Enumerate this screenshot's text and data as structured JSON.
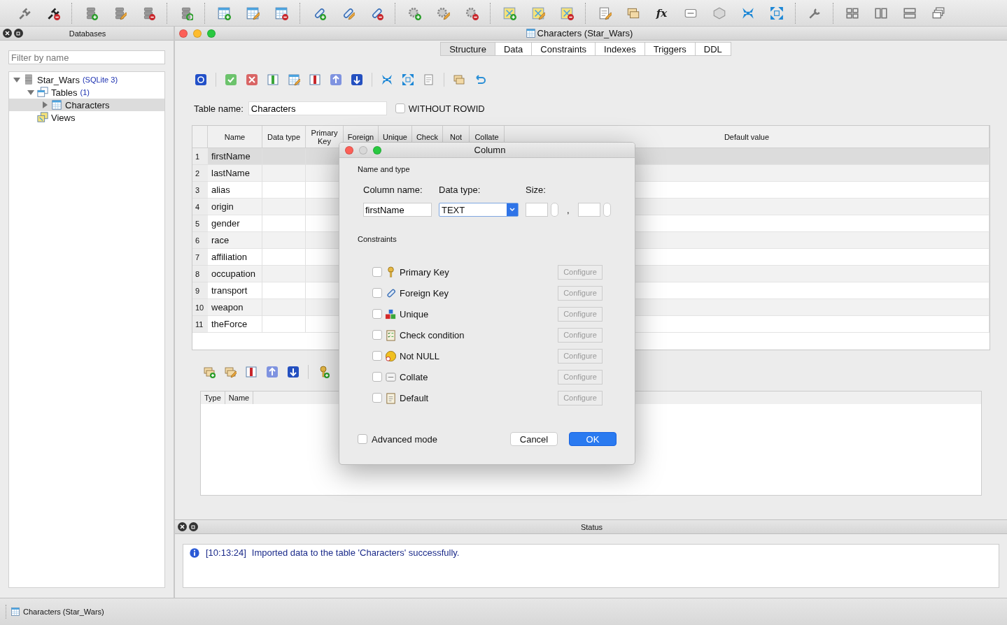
{
  "main_toolbar": {
    "function_button": "fx"
  },
  "databases_panel": {
    "title": "Databases",
    "filter": {
      "placeholder": "Filter by name"
    },
    "tree": [
      {
        "label": "Star_Wars",
        "detail": "(SQLite 3)",
        "kind": "database",
        "expanded": true,
        "selected": false,
        "children": [
          {
            "label": "Tables",
            "detail": "(1)",
            "kind": "tables",
            "expanded": true,
            "selected": false,
            "children": [
              {
                "label": "Characters",
                "kind": "table",
                "expanded": false,
                "selected": true
              }
            ]
          },
          {
            "label": "Views",
            "kind": "views",
            "selected": false
          }
        ]
      }
    ]
  },
  "editor_window": {
    "title": "Characters (Star_Wars)",
    "tabs": [
      {
        "label": "Structure",
        "selected": true
      },
      {
        "label": "Data",
        "selected": false
      },
      {
        "label": "Constraints",
        "selected": false
      },
      {
        "label": "Indexes",
        "selected": false
      },
      {
        "label": "Triggers",
        "selected": false
      },
      {
        "label": "DDL",
        "selected": false
      }
    ],
    "table_name_label": "Table name:",
    "table_name": "Characters",
    "without_rowid": {
      "label": "WITHOUT ROWID",
      "checked": false
    },
    "columns_table": {
      "columns": [
        "Name",
        "Data type",
        "Primary Key",
        "Foreign",
        "Unique",
        "Check",
        "Not",
        "Collate",
        "Default value"
      ],
      "rows": [
        {
          "number": "1",
          "name": "firstName",
          "selected": true
        },
        {
          "number": "2",
          "name": "lastName",
          "selected": false
        },
        {
          "number": "3",
          "name": "alias",
          "selected": false
        },
        {
          "number": "4",
          "name": "origin",
          "selected": false
        },
        {
          "number": "5",
          "name": "gender",
          "selected": false
        },
        {
          "number": "6",
          "name": "race",
          "selected": false
        },
        {
          "number": "7",
          "name": "affiliation",
          "selected": false
        },
        {
          "number": "8",
          "name": "occupation",
          "selected": false
        },
        {
          "number": "9",
          "name": "transport",
          "selected": false
        },
        {
          "number": "10",
          "name": "weapon",
          "selected": false
        },
        {
          "number": "11",
          "name": "theForce",
          "selected": false
        }
      ]
    },
    "constraints_table": {
      "columns": [
        "Type",
        "Name"
      ]
    }
  },
  "status_panel": {
    "title": "Status",
    "messages": [
      {
        "time": "[10:13:24]",
        "text": "Imported data to the table 'Characters' successfully."
      }
    ]
  },
  "taskbar": [
    {
      "label": "Characters (Star_Wars)"
    }
  ],
  "column_dialog": {
    "title": "Column",
    "name_type_title": "Name and type",
    "column_name_label": "Column name:",
    "column_name": "firstName",
    "data_type_label": "Data type:",
    "data_type": "TEXT",
    "size_label": "Size:",
    "size_separator": ",",
    "constraints_title": "Constraints",
    "constraints": [
      {
        "label": "Primary Key",
        "kind": "key",
        "checked": false,
        "button": "Configure",
        "button_disabled": true
      },
      {
        "label": "Foreign Key",
        "kind": "link",
        "checked": false,
        "button": "Configure",
        "button_disabled": true
      },
      {
        "label": "Unique",
        "kind": "blocks",
        "checked": false,
        "button": "Configure",
        "button_disabled": true
      },
      {
        "label": "Check condition",
        "kind": "checklist",
        "checked": false,
        "button": "Configure",
        "button_disabled": true
      },
      {
        "label": "Not NULL",
        "kind": "null",
        "checked": false,
        "button": "Configure",
        "button_disabled": true
      },
      {
        "label": "Collate",
        "kind": "sort",
        "checked": false,
        "button": "Configure",
        "button_disabled": true
      },
      {
        "label": "Default",
        "kind": "clipboard",
        "checked": false,
        "button": "Configure",
        "button_disabled": true
      }
    ],
    "advanced_mode": {
      "label": "Advanced mode",
      "checked": false
    },
    "buttons": [
      {
        "label": "Cancel",
        "kind": "secondary"
      },
      {
        "label": "OK",
        "kind": "primary"
      }
    ]
  }
}
